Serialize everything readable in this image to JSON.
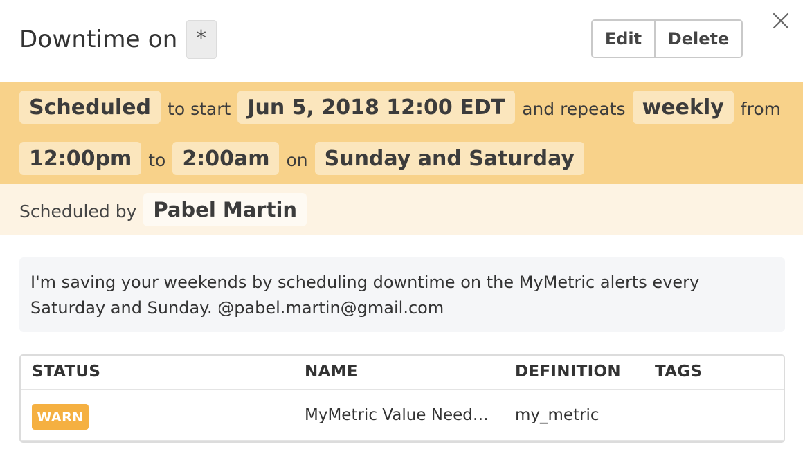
{
  "header": {
    "title": "Downtime on",
    "scope": "*",
    "edit_label": "Edit",
    "delete_label": "Delete",
    "close_icon": "close-icon"
  },
  "schedule": {
    "status": "Scheduled",
    "to_start": "to start",
    "start": "Jun 5, 2018 12:00 EDT",
    "and_repeats": "and repeats",
    "repeat": "weekly",
    "from": "from",
    "time_from": "12:00pm",
    "to": "to",
    "time_to": "2:00am",
    "on": "on",
    "days": "Sunday and Saturday"
  },
  "scheduled_by": {
    "label": "Scheduled by",
    "name": "Pabel Martin"
  },
  "message": "I'm saving your weekends by scheduling downtime on the MyMetric alerts every Saturday and Sunday. @pabel.martin@gmail.com",
  "table": {
    "columns": {
      "status": "STATUS",
      "name": "NAME",
      "definition": "DEFINITION",
      "tags": "TAGS"
    },
    "rows": [
      {
        "status": "WARN",
        "name": "MyMetric Value Need…",
        "definition": "my_metric",
        "tags": ""
      }
    ]
  },
  "colors": {
    "schedule_band": "#f8d28a",
    "scheduled_by_band": "#fdf3e3",
    "warn_badge": "#f5b041"
  }
}
